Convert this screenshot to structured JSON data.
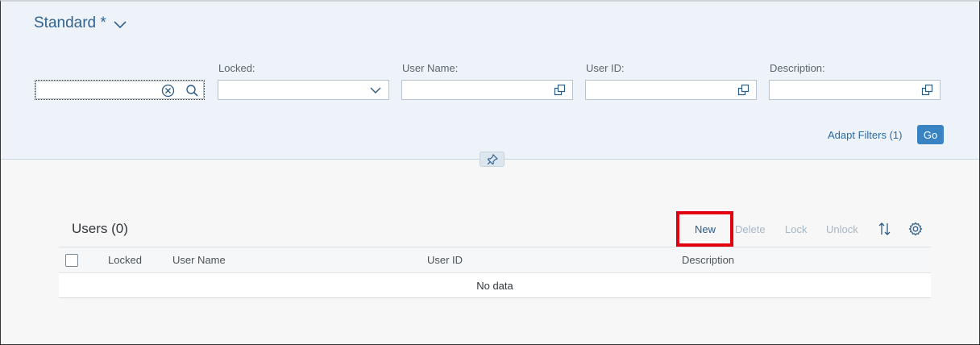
{
  "filter_bar": {
    "variant_label": "Standard *",
    "filters": [
      {
        "label": "",
        "value": "",
        "type": "search"
      },
      {
        "label": "Locked:",
        "value": "",
        "type": "select"
      },
      {
        "label": "User Name:",
        "value": "",
        "type": "value-help"
      },
      {
        "label": "User ID:",
        "value": "",
        "type": "value-help"
      },
      {
        "label": "Description:",
        "value": "",
        "type": "value-help"
      }
    ],
    "adapt_filters_label": "Adapt Filters (1)",
    "go_label": "Go"
  },
  "table": {
    "title": "Users (0)",
    "toolbar": {
      "new_label": "New",
      "delete_label": "Delete",
      "lock_label": "Lock",
      "unlock_label": "Unlock",
      "sort_icon": "sort-icon",
      "settings_icon": "gear-icon"
    },
    "columns": [
      "Locked",
      "User Name",
      "User ID",
      "Description"
    ],
    "no_data_text": "No data"
  },
  "colors": {
    "accent": "#3a83c2",
    "link": "#2b6aa3",
    "highlight": "#e0000f",
    "disabled": "#a7b6c6"
  }
}
